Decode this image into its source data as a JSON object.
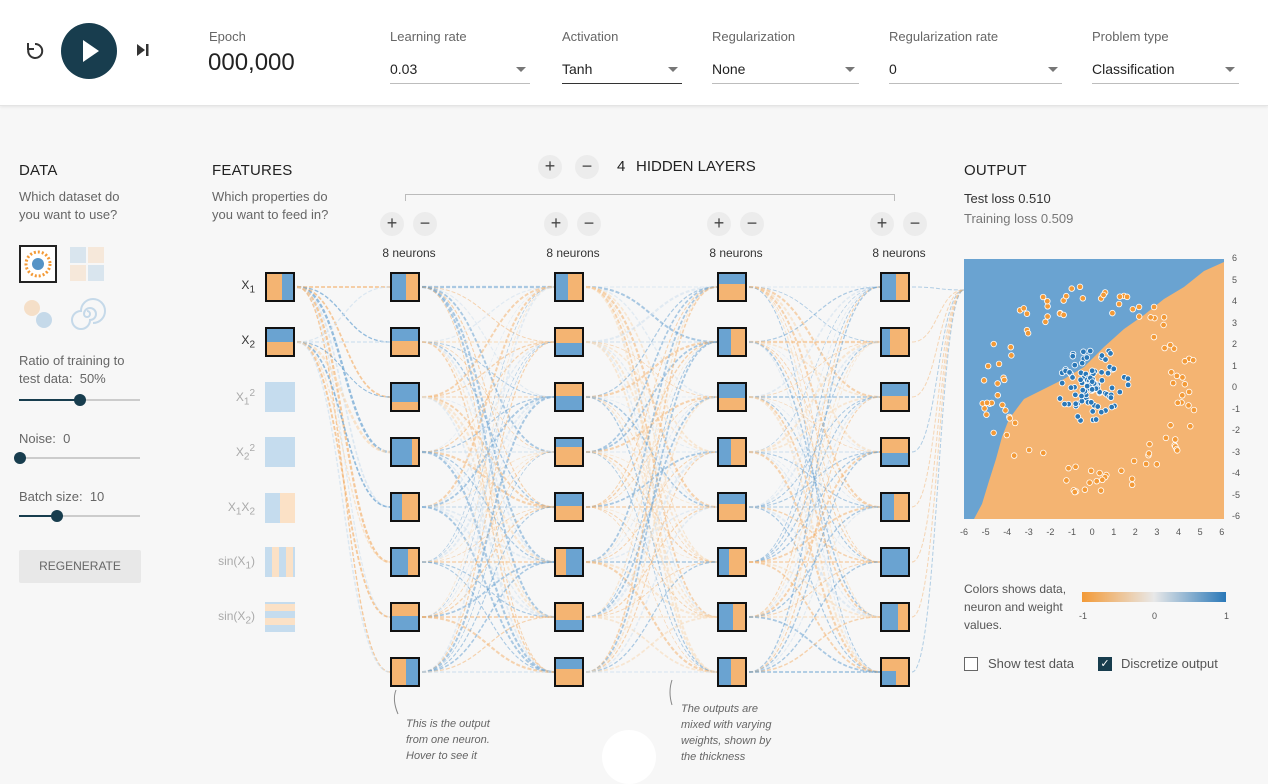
{
  "toolbar": {
    "reset_icon": "reset-icon",
    "play_icon": "play-icon",
    "step_icon": "step-forward-icon",
    "epoch_label": "Epoch",
    "epoch_value": "000,000",
    "learning_rate": {
      "label": "Learning rate",
      "value": "0.03"
    },
    "activation": {
      "label": "Activation",
      "value": "Tanh"
    },
    "regularization": {
      "label": "Regularization",
      "value": "None"
    },
    "regularization_rate": {
      "label": "Regularization rate",
      "value": "0"
    },
    "problem_type": {
      "label": "Problem type",
      "value": "Classification"
    }
  },
  "data_panel": {
    "title": "DATA",
    "question": "Which dataset do you want to use?",
    "datasets": [
      "circle",
      "xor",
      "gaussian",
      "spiral"
    ],
    "ratio_label": "Ratio of training to test data:",
    "ratio_value": "50%",
    "ratio_level": 0.5,
    "noise_label": "Noise:",
    "noise_value": "0",
    "noise_level": 0.0,
    "batch_label": "Batch size:",
    "batch_value": "10",
    "batch_level": 0.31,
    "regenerate": "REGENERATE"
  },
  "features_panel": {
    "title": "FEATURES",
    "question": "Which properties do you want to feed in?",
    "features": [
      {
        "label": "X1",
        "active": true
      },
      {
        "label": "X2",
        "active": true
      },
      {
        "label": "X1²",
        "active": false
      },
      {
        "label": "X2²",
        "active": false
      },
      {
        "label": "X1X2",
        "active": false
      },
      {
        "label": "sin(X1)",
        "active": false
      },
      {
        "label": "sin(X2)",
        "active": false
      }
    ]
  },
  "network": {
    "hidden_layers_count": "4",
    "hidden_layers_label": "HIDDEN LAYERS",
    "layers": [
      {
        "neurons_label": "8 neurons"
      },
      {
        "neurons_label": "8 neurons"
      },
      {
        "neurons_label": "8 neurons"
      },
      {
        "neurons_label": "8 neurons"
      }
    ],
    "note_neuron": "This is the output from one neuron. Hover to see it",
    "note_weights": "The outputs are mixed with varying weights, shown by the thickness"
  },
  "output_panel": {
    "title": "OUTPUT",
    "test_loss_label": "Test loss",
    "test_loss_value": "0.510",
    "training_loss_label": "Training loss",
    "training_loss_value": "0.509",
    "legend_text": "Colors shows data, neuron and weight values.",
    "legend_ticks": [
      "-1",
      "0",
      "1"
    ],
    "show_test_data": {
      "label": "Show test data",
      "checked": false
    },
    "discretize_output": {
      "label": "Discretize output",
      "checked": true
    },
    "x_ticks": [
      "-6",
      "-5",
      "-4",
      "-3",
      "-2",
      "-1",
      "0",
      "1",
      "2",
      "3",
      "4",
      "5",
      "6"
    ],
    "y_ticks": [
      "6",
      "5",
      "4",
      "3",
      "2",
      "1",
      "0",
      "-1",
      "-2",
      "-3",
      "-4",
      "-5",
      "-6"
    ]
  },
  "colors": {
    "orange": "#f4b472",
    "blue": "#6aa3d1",
    "dark": "#183d4e",
    "point_orange": "#f39a37",
    "point_blue": "#2a78b8"
  }
}
